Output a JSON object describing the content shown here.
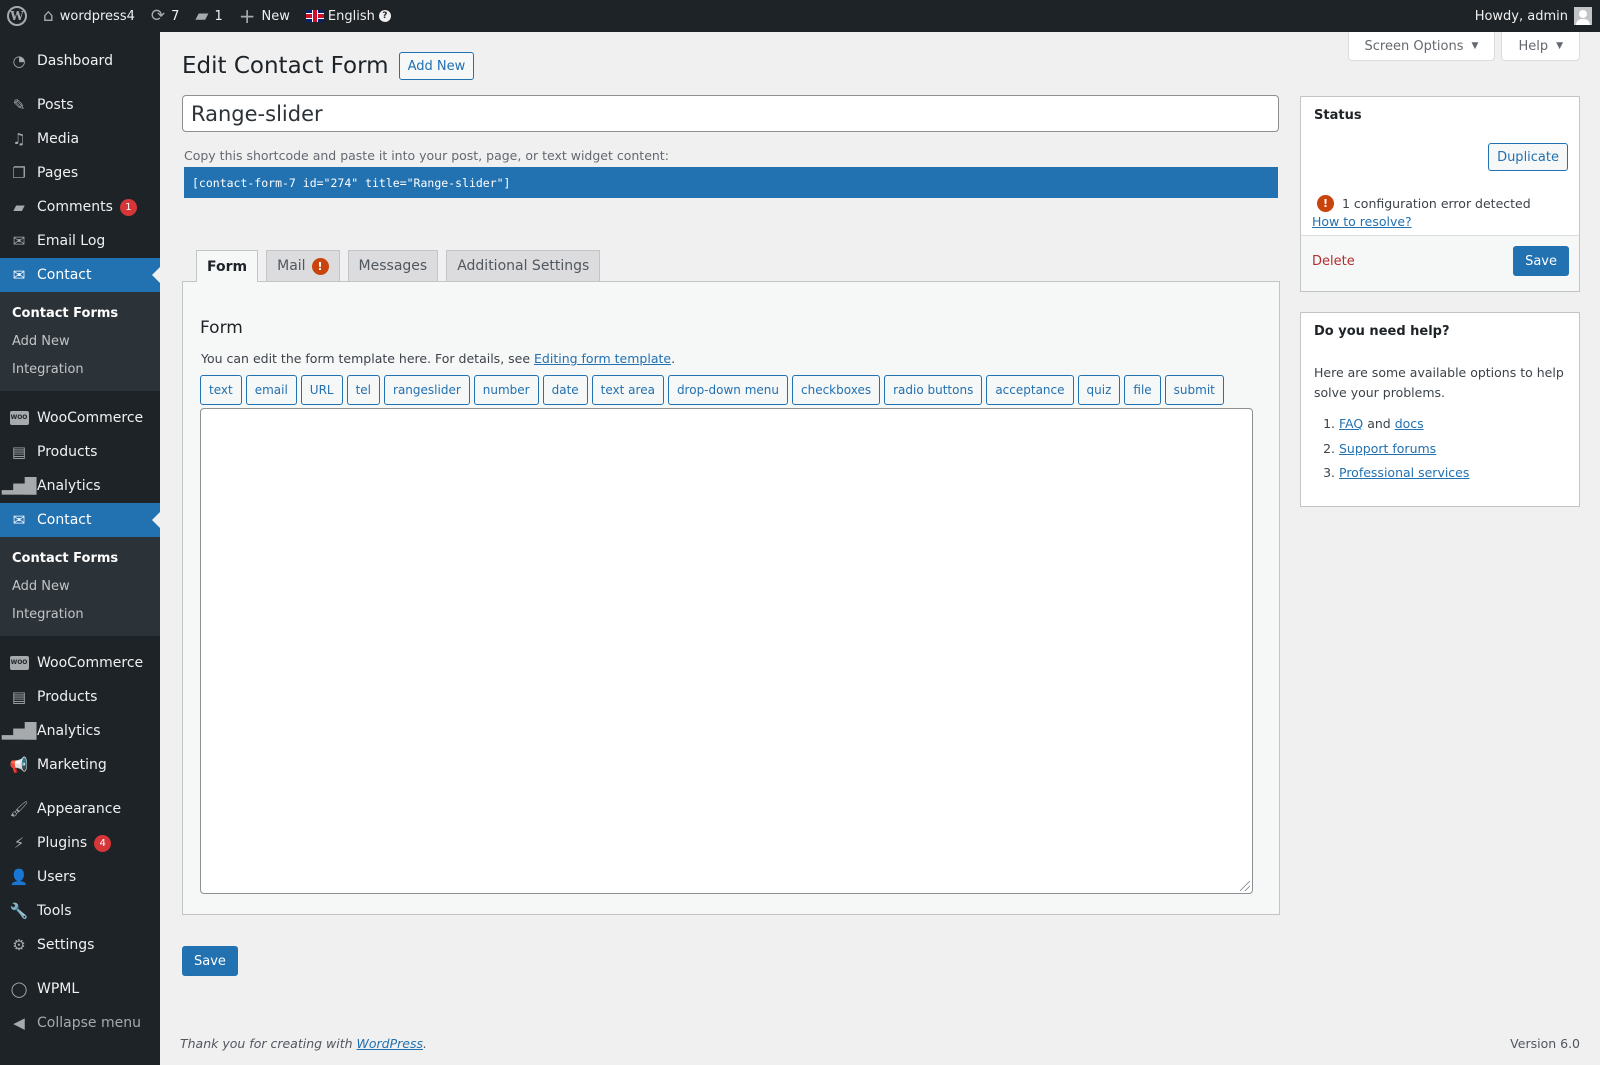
{
  "adminbar": {
    "site_name": "wordpress4",
    "updates_count": "7",
    "comments_count": "1",
    "new_label": "New",
    "language": "English",
    "howdy": "Howdy, admin"
  },
  "sidebar": {
    "items": [
      {
        "label": "Dashboard",
        "icon": "dashboard-icon"
      },
      {
        "label": "Posts",
        "icon": "pin-icon"
      },
      {
        "label": "Media",
        "icon": "media-icon"
      },
      {
        "label": "Pages",
        "icon": "pages-icon"
      },
      {
        "label": "Comments",
        "icon": "comment-icon",
        "badge": "1"
      },
      {
        "label": "Email Log",
        "icon": "envelope-icon"
      },
      {
        "label": "Contact",
        "icon": "mail-icon",
        "current": true
      },
      {
        "label": "WooCommerce",
        "icon": "woo-icon"
      },
      {
        "label": "Products",
        "icon": "archive-icon"
      },
      {
        "label": "Analytics",
        "icon": "bar-chart-icon"
      },
      {
        "label": "Contact",
        "icon": "mail-icon",
        "current": true
      },
      {
        "label": "WooCommerce",
        "icon": "woo-icon"
      },
      {
        "label": "Products",
        "icon": "archive-icon"
      },
      {
        "label": "Analytics",
        "icon": "bar-chart-icon"
      },
      {
        "label": "Marketing",
        "icon": "megaphone-icon"
      },
      {
        "label": "Appearance",
        "icon": "paintbrush-icon"
      },
      {
        "label": "Plugins",
        "icon": "plug-icon",
        "badge": "4"
      },
      {
        "label": "Users",
        "icon": "user-icon"
      },
      {
        "label": "Tools",
        "icon": "wrench-icon"
      },
      {
        "label": "Settings",
        "icon": "sliders-icon"
      },
      {
        "label": "WPML",
        "icon": "wpml-icon"
      },
      {
        "label": "Collapse menu",
        "icon": "collapse-icon"
      }
    ],
    "submenu": [
      "Contact Forms",
      "Add New",
      "Integration"
    ]
  },
  "screen_meta": {
    "screen_options": "Screen Options",
    "help": "Help"
  },
  "page": {
    "title": "Edit Contact Form",
    "add_new": "Add New",
    "form_title_value": "Range-slider",
    "shortcode_label": "Copy this shortcode and paste it into your post, page, or text widget content:",
    "shortcode": "[contact-form-7 id=\"274\" title=\"Range-slider\"]"
  },
  "tabs": [
    {
      "label": "Form",
      "active": true
    },
    {
      "label": "Mail",
      "error": true
    },
    {
      "label": "Messages"
    },
    {
      "label": "Additional Settings"
    }
  ],
  "form_panel": {
    "heading": "Form",
    "desc_prefix": "You can edit the form template here. For details, see ",
    "desc_link": "Editing form template",
    "desc_suffix": ".",
    "tags": [
      "text",
      "email",
      "URL",
      "tel",
      "rangeslider",
      "number",
      "date",
      "text area",
      "drop-down menu",
      "checkboxes",
      "radio buttons",
      "acceptance",
      "quiz",
      "file",
      "submit"
    ],
    "template_value": "",
    "save": "Save"
  },
  "status_box": {
    "title": "Status",
    "duplicate": "Duplicate",
    "error_text": "1 configuration error detected",
    "resolve_link": "How to resolve?",
    "delete": "Delete",
    "save": "Save"
  },
  "help_box": {
    "title": "Do you need help?",
    "text": "Here are some available options to help solve your problems.",
    "faq": "FAQ",
    "and": " and ",
    "docs": "docs",
    "support": "Support forums",
    "professional": "Professional services"
  },
  "footer": {
    "thanks_prefix": "Thank you for creating with ",
    "thanks_link": "WordPress",
    "thanks_suffix": ".",
    "version": "Version 6.0"
  },
  "colors": {
    "accent": "#2271b1",
    "sidebar_bg": "#1d2327",
    "error": "#d63638",
    "delete": "#b32d2e"
  }
}
